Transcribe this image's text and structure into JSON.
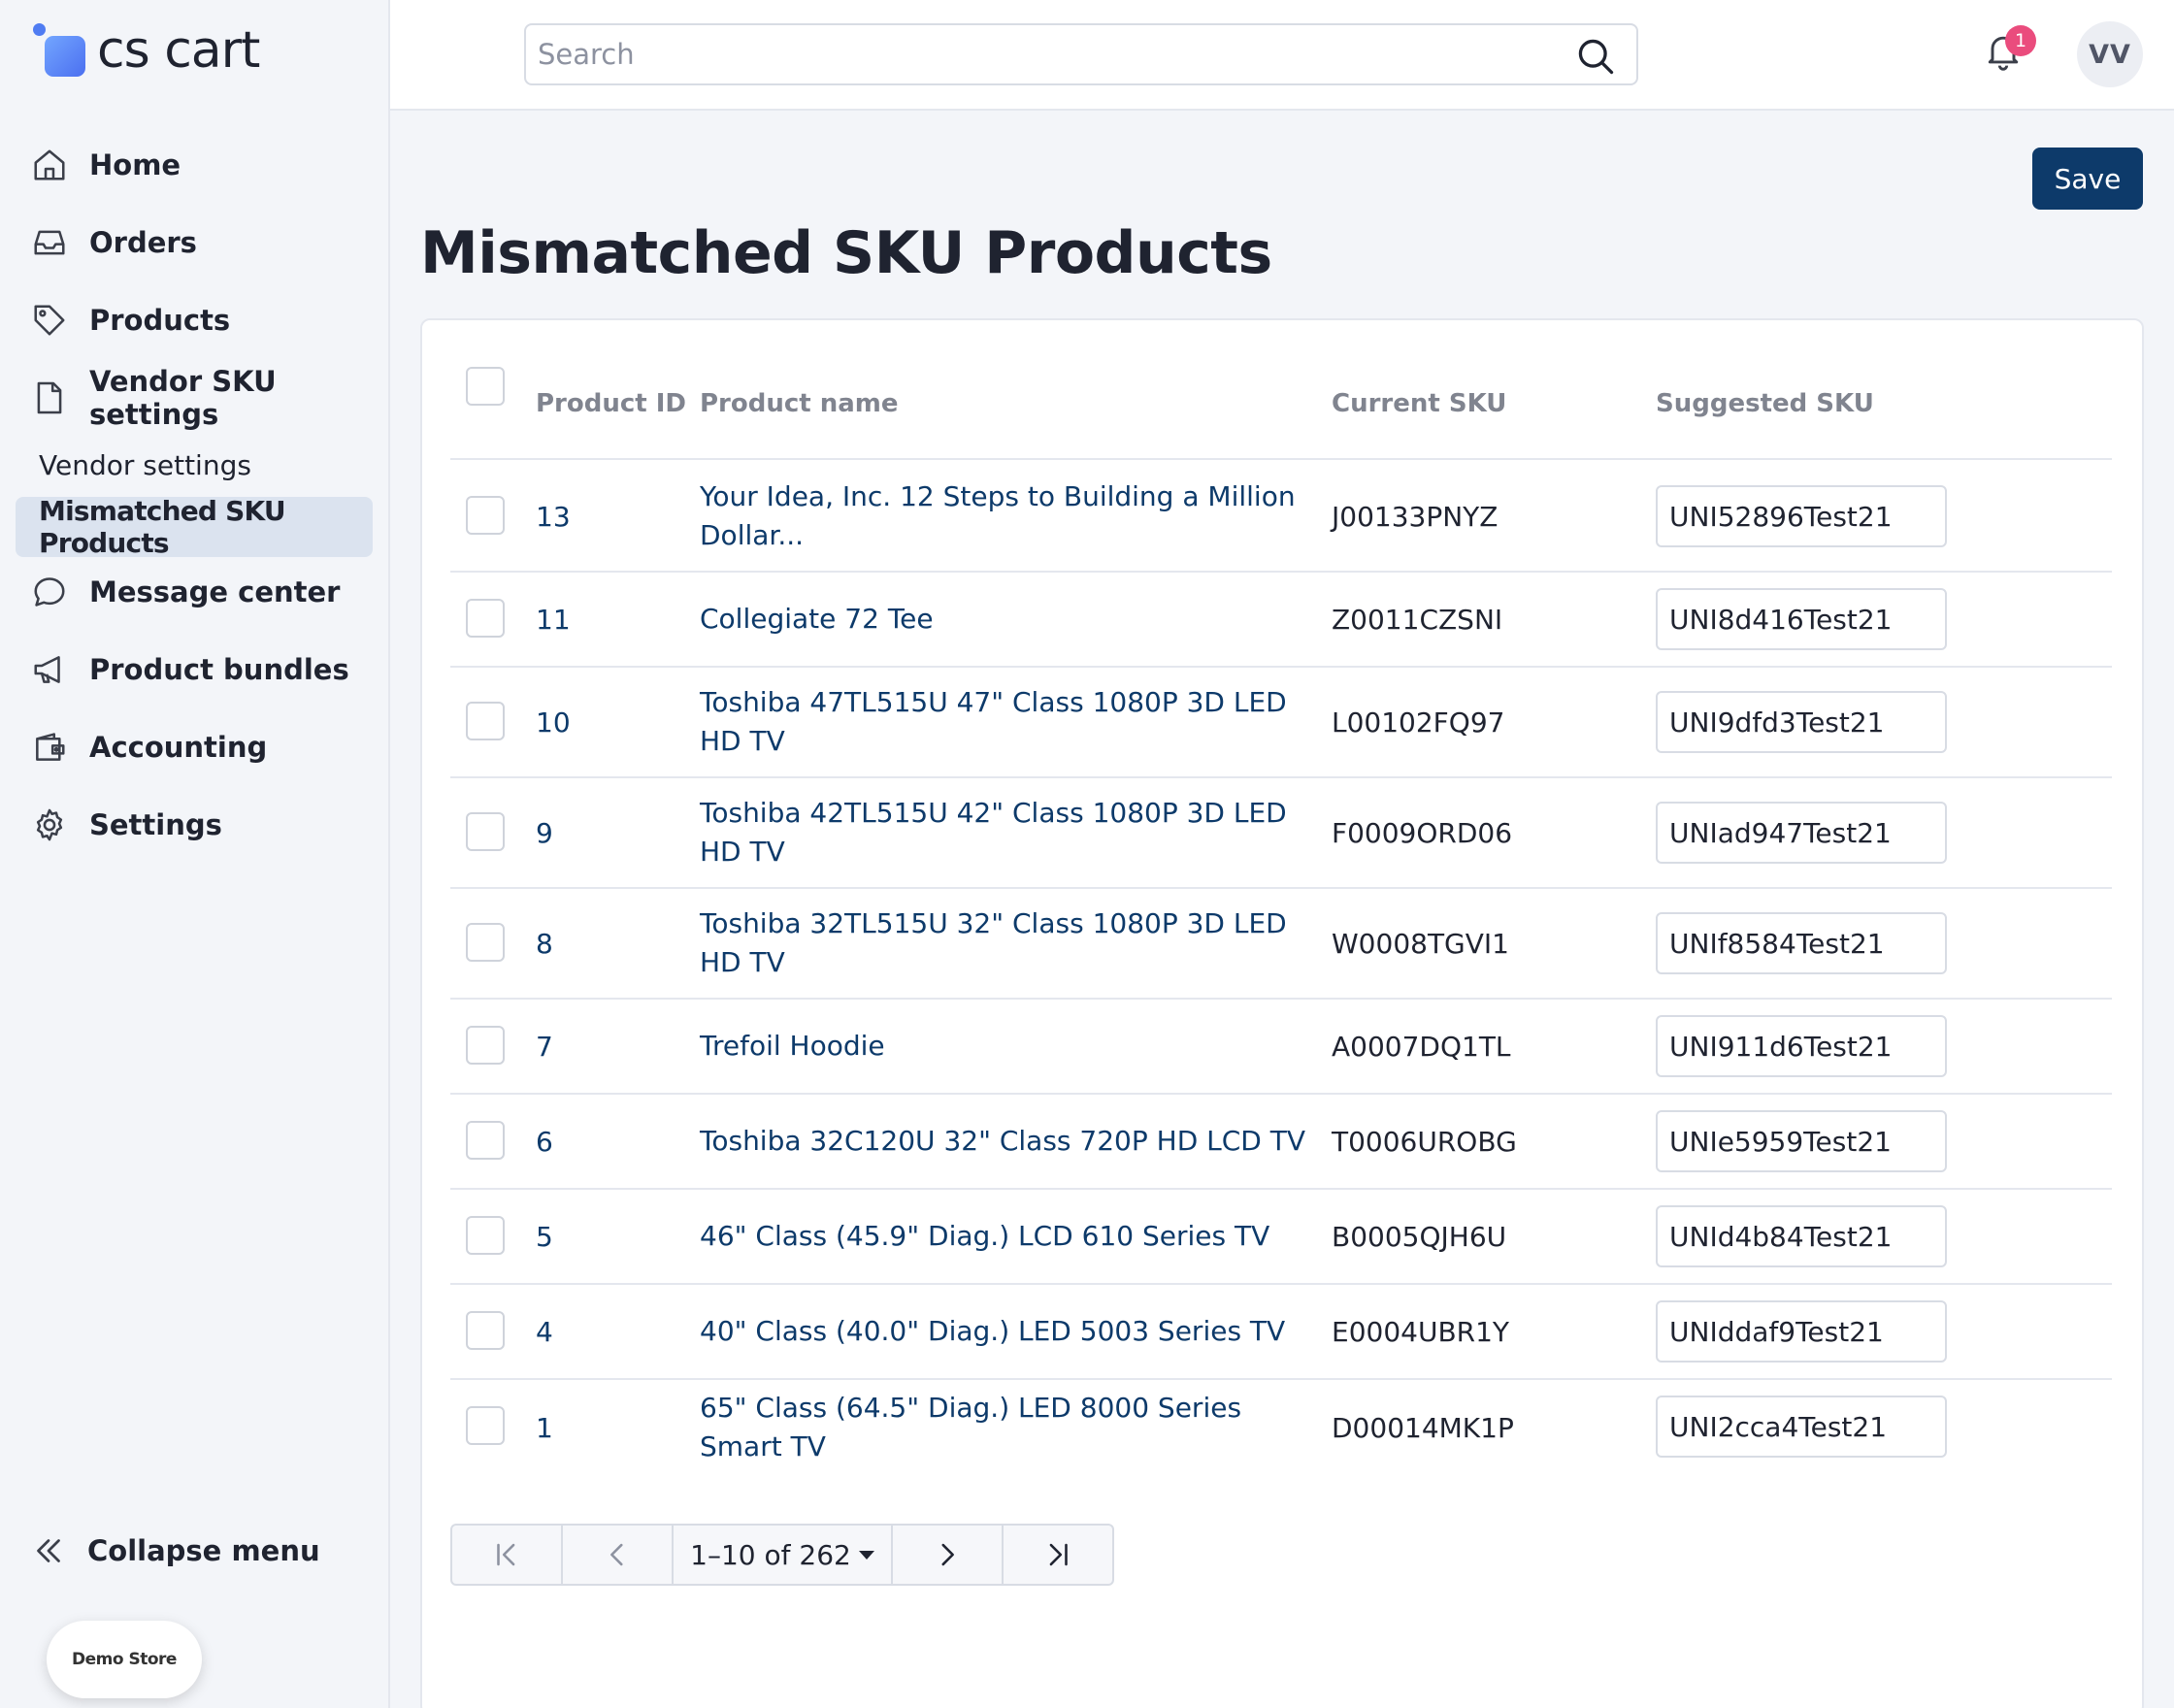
{
  "app": {
    "logo_text": "cs cart",
    "demo_store": "Demo Store"
  },
  "sidebar": {
    "items": [
      {
        "label": "Home",
        "icon": "home-icon"
      },
      {
        "label": "Orders",
        "icon": "inbox-icon"
      },
      {
        "label": "Products",
        "icon": "tag-icon"
      },
      {
        "label": "Vendor SKU settings",
        "icon": "document-icon"
      },
      {
        "label": "Message center",
        "icon": "chat-icon"
      },
      {
        "label": "Product bundles",
        "icon": "megaphone-icon"
      },
      {
        "label": "Accounting",
        "icon": "wallet-icon"
      },
      {
        "label": "Settings",
        "icon": "gear-icon"
      }
    ],
    "sub_items": [
      {
        "label": "Vendor settings",
        "active": false
      },
      {
        "label": "Mismatched SKU Products",
        "active": true
      }
    ],
    "collapse_label": "Collapse menu"
  },
  "topbar": {
    "search_placeholder": "Search",
    "notification_count": "1",
    "avatar_initials": "VV"
  },
  "main": {
    "save_label": "Save",
    "title": "Mismatched SKU Products",
    "columns": [
      "Product ID",
      "Product name",
      "Current SKU",
      "Suggested SKU"
    ],
    "rows": [
      {
        "id": "13",
        "name": "Your Idea, Inc. 12 Steps to Building a Million Dollar...",
        "current_sku": "J00133PNYZ",
        "suggested_sku": "UNI52896Test21"
      },
      {
        "id": "11",
        "name": "Collegiate 72 Tee",
        "current_sku": "Z0011CZSNI",
        "suggested_sku": "UNI8d416Test21"
      },
      {
        "id": "10",
        "name": "Toshiba 47TL515U 47\" Class 1080P 3D LED HD TV",
        "current_sku": "L00102FQ97",
        "suggested_sku": "UNI9dfd3Test21"
      },
      {
        "id": "9",
        "name": "Toshiba 42TL515U 42\" Class 1080P 3D LED HD TV",
        "current_sku": "F0009ORD06",
        "suggested_sku": "UNIad947Test21"
      },
      {
        "id": "8",
        "name": "Toshiba 32TL515U 32\" Class 1080P 3D LED HD TV",
        "current_sku": "W0008TGVI1",
        "suggested_sku": "UNIf8584Test21"
      },
      {
        "id": "7",
        "name": "Trefoil Hoodie",
        "current_sku": "A0007DQ1TL",
        "suggested_sku": "UNI911d6Test21"
      },
      {
        "id": "6",
        "name": "Toshiba 32C120U 32\" Class 720P HD LCD TV",
        "current_sku": "T0006UROBG",
        "suggested_sku": "UNIe5959Test21"
      },
      {
        "id": "5",
        "name": "46\" Class (45.9\" Diag.) LCD 610 Series TV",
        "current_sku": "B0005QJH6U",
        "suggested_sku": "UNId4b84Test21"
      },
      {
        "id": "4",
        "name": "40\" Class (40.0\" Diag.) LED 5003 Series TV",
        "current_sku": "E0004UBR1Y",
        "suggested_sku": "UNIddaf9Test21"
      },
      {
        "id": "1",
        "name": "65\" Class (64.5\" Diag.) LED 8000 Series Smart TV",
        "current_sku": "D00014MK1P",
        "suggested_sku": "UNI2cca4Test21"
      }
    ],
    "pagination": {
      "range_label": "1–10 of 262"
    }
  }
}
